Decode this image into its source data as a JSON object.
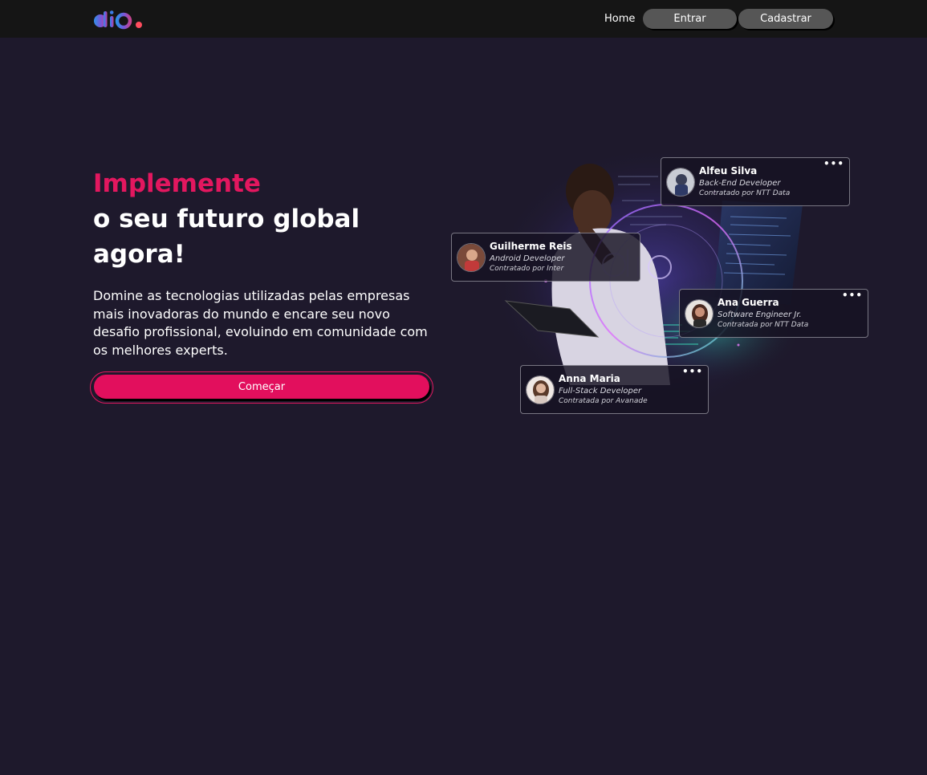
{
  "header": {
    "logo_alt": "dio.",
    "nav": {
      "home_label": "Home"
    },
    "buttons": {
      "login_label": "Entrar",
      "signup_label": "Cadastrar"
    }
  },
  "hero": {
    "title_accent": "Implemente",
    "title_main": "o seu futuro global agora!",
    "subtitle": "Domine as tecnologias utilizadas pelas empresas mais inovadoras do mundo e encare seu novo desafio profissional, evoluindo em comunidade com os melhores experts.",
    "cta_label": "Começar"
  },
  "cards": [
    {
      "name": "Alfeu Silva",
      "role": "Back-End Developer",
      "company": "Contratado por NTT Data",
      "more": "•••"
    },
    {
      "name": "Guilherme Reis",
      "role": "Android Developer",
      "company": "Contratado por Inter",
      "more": ""
    },
    {
      "name": "Ana Guerra",
      "role": "Software Engineer Jr.",
      "company": "Contratada por NTT Data",
      "more": "•••"
    },
    {
      "name": "Anna Maria",
      "role": "Full-Stack Developer",
      "company": "Contratada por Avanade",
      "more": "•••"
    }
  ],
  "colors": {
    "background": "#1e192c",
    "header": "#151515",
    "accent": "#e3175f",
    "nav_button": "#565656"
  }
}
